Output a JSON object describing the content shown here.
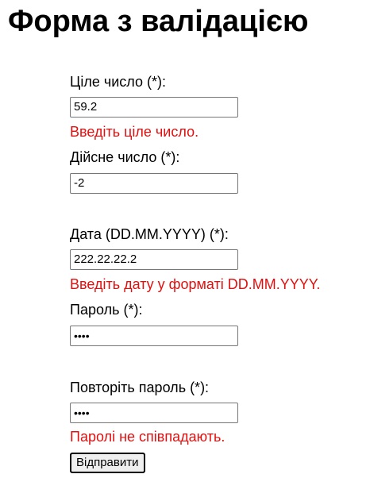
{
  "page": {
    "title": "Форма з валідацією"
  },
  "colors": {
    "error": "#e01010"
  },
  "form": {
    "integer": {
      "label": "Ціле число (*):",
      "value": "59.2",
      "error": "Введіть ціле число."
    },
    "real": {
      "label": "Дійсне число (*):",
      "value": "-2"
    },
    "date": {
      "label": "Дата (DD.MM.YYYY) (*):",
      "value": "222.22.22.2",
      "error": "Введіть дату у форматі DD.MM.YYYY."
    },
    "password": {
      "label": "Пароль (*):",
      "value": "••••"
    },
    "password_repeat": {
      "label": "Повторіть пароль (*):",
      "value": "••••",
      "error": "Паролі не співпадають."
    },
    "submit_label": "Відправити"
  }
}
